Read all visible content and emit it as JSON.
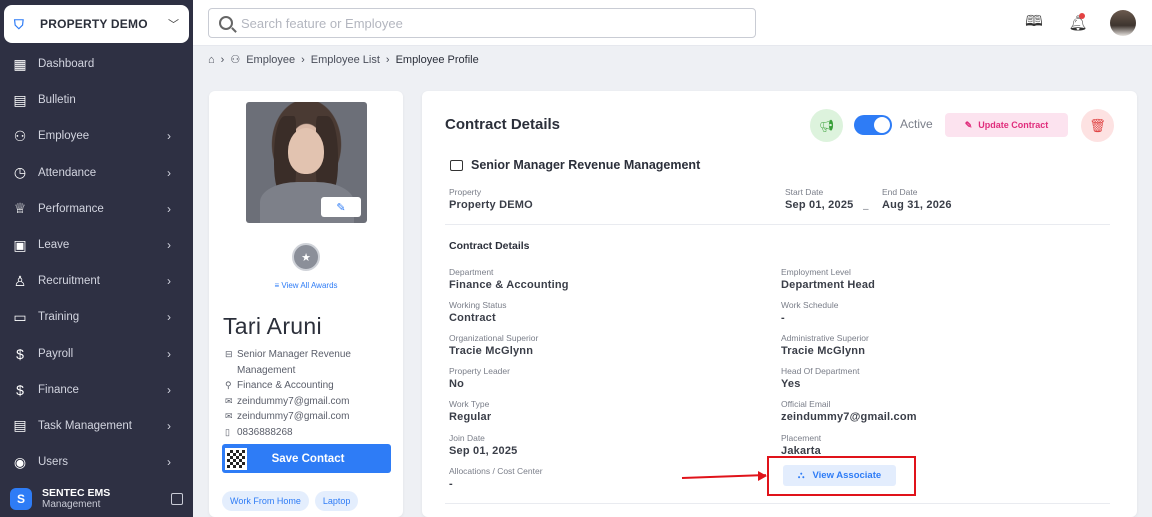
{
  "sidebar": {
    "property_name": "PROPERTY DEMO",
    "items": [
      {
        "label": "Dashboard",
        "icon": "dashboard-icon",
        "has_arrow": false
      },
      {
        "label": "Bulletin",
        "icon": "bulletin-icon",
        "has_arrow": false
      },
      {
        "label": "Employee",
        "icon": "employee-icon",
        "has_arrow": true
      },
      {
        "label": "Attendance",
        "icon": "clock-icon",
        "has_arrow": true
      },
      {
        "label": "Performance",
        "icon": "trophy-icon",
        "has_arrow": true
      },
      {
        "label": "Leave",
        "icon": "calendar-icon",
        "has_arrow": true
      },
      {
        "label": "Recruitment",
        "icon": "recruitment-icon",
        "has_arrow": true
      },
      {
        "label": "Training",
        "icon": "training-icon",
        "has_arrow": true
      },
      {
        "label": "Payroll",
        "icon": "payroll-icon",
        "has_arrow": true
      },
      {
        "label": "Finance",
        "icon": "dollar-icon",
        "has_arrow": true
      },
      {
        "label": "Task Management",
        "icon": "task-icon",
        "has_arrow": true
      },
      {
        "label": "Users",
        "icon": "users-icon",
        "has_arrow": true
      }
    ],
    "brand_title": "SENTEC EMS",
    "brand_subtitle": "Management"
  },
  "topbar": {
    "search_placeholder": "Search feature or Employee"
  },
  "breadcrumb": {
    "items": [
      "Employee",
      "Employee List"
    ],
    "current": "Employee Profile"
  },
  "profile": {
    "view_awards": "View All Awards",
    "name": "Tari Aruni",
    "position_line1": "Senior Manager Revenue",
    "position_line2": "Management",
    "department": "Finance & Accounting",
    "email1": "zeindummy7@gmail.com",
    "email2": "zeindummy7@gmail.com",
    "phone": "0836888268",
    "save_contact": "Save Contact",
    "tags": [
      "Work From Home",
      "Laptop"
    ]
  },
  "contract": {
    "title": "Contract Details",
    "status_label": "Active",
    "update_label": "Update Contract",
    "position": "Senior Manager Revenue Management",
    "property_label": "Property",
    "property_value": "Property DEMO",
    "start_label": "Start Date",
    "start_value": "Sep 01, 2025",
    "end_label": "End Date",
    "end_value": "Aug 31, 2026",
    "section_title": "Contract Details",
    "fields_left": [
      {
        "label": "Department",
        "value": "Finance & Accounting"
      },
      {
        "label": "Working Status",
        "value": "Contract"
      },
      {
        "label": "Organizational Superior",
        "value": "Tracie McGlynn"
      },
      {
        "label": "Property Leader",
        "value": "No"
      },
      {
        "label": "Work Type",
        "value": "Regular"
      },
      {
        "label": "Join Date",
        "value": "Sep 01, 2025"
      },
      {
        "label": "Allocations / Cost Center",
        "value": "-"
      }
    ],
    "fields_right": [
      {
        "label": "Employment Level",
        "value": "Department Head"
      },
      {
        "label": "Work Schedule",
        "value": "-"
      },
      {
        "label": "Administrative Superior",
        "value": "Tracie McGlynn"
      },
      {
        "label": "Head Of Department",
        "value": "Yes"
      },
      {
        "label": "Official Email",
        "value": "zeindummy7@gmail.com"
      },
      {
        "label": "Placement",
        "value": "Jakarta"
      }
    ],
    "view_associate": "View Associate"
  }
}
